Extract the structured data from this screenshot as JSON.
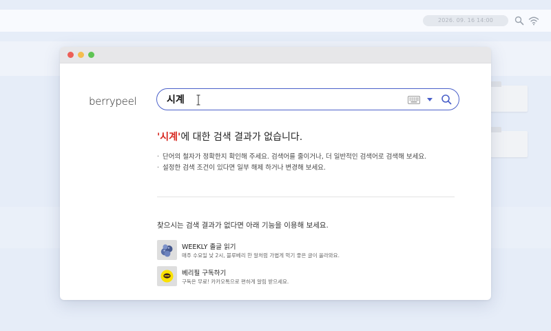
{
  "menubar": {
    "datetime": "2026. 09. 16 14:00"
  },
  "search": {
    "query": "시계",
    "placeholder": ""
  },
  "result": {
    "query_quoted": "'시계'",
    "message_suffix": "에 대한 검색 결과가 없습니다.",
    "tips": [
      "단어의 철자가 정확한지 확인해 주세요. 검색어를 줄이거나, 더 일반적인 검색어로 검색해 보세요.",
      "설정한 검색 조건이 있다면 일부 해제 하거나 변경해 보세요."
    ]
  },
  "suggestions": {
    "heading": "찾으시는 검색 결과가 없다면 아래 기능을 이용해 보세요.",
    "items": [
      {
        "title": "WEEKLY 졸글 읽기",
        "desc": "매주 수요일 낮 2시, 블루베리 한 알처럼 가볍게 먹기 좋은 글이 올라와요."
      },
      {
        "title": "베리필 구독하기",
        "desc": "구독은 무료! 카카오톡으로 편하게 알림 받으세요."
      }
    ]
  },
  "colors": {
    "accent": "#4a60c9",
    "query_red": "#d7261e",
    "kakao_yellow": "#fae100"
  },
  "icons": {
    "search": "search-icon",
    "keyboard": "keyboard-icon",
    "dropdown": "chevron-down-icon",
    "wifi": "wifi-icon",
    "spotlight": "spotlight-search-icon"
  }
}
